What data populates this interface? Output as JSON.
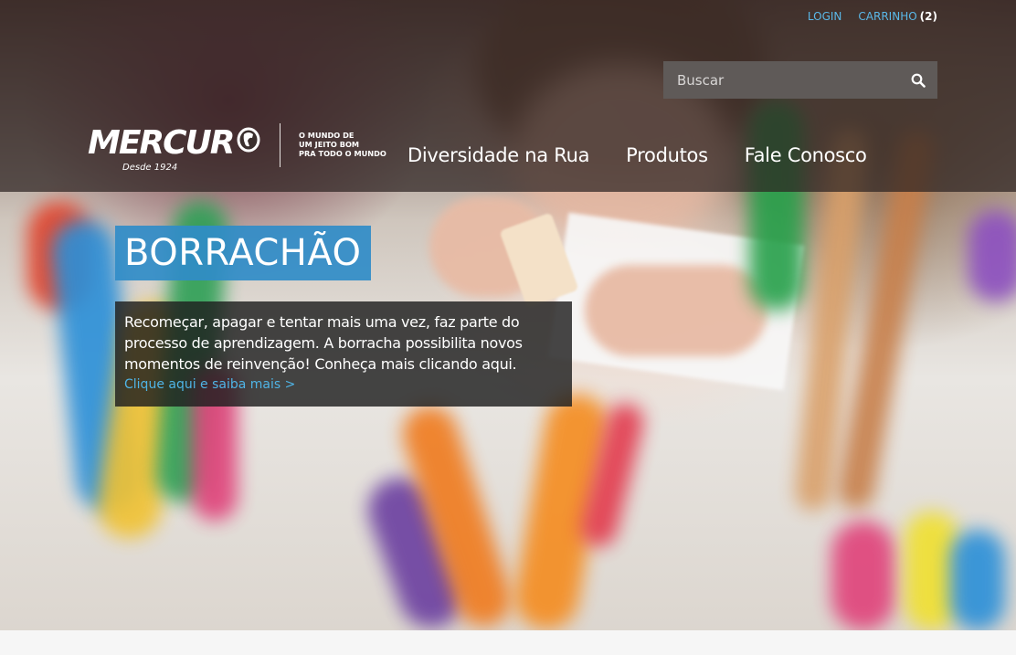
{
  "topnav": {
    "login": "LOGIN",
    "cart": "CARRINHO",
    "cart_count": "(2)"
  },
  "search": {
    "placeholder": "Buscar"
  },
  "logo": {
    "name": "MERCUR",
    "since": "Desde 1924"
  },
  "tagline": {
    "line1": "O MUNDO DE",
    "line2": "UM JEITO BOM",
    "line3": "PRA TODO O MUNDO"
  },
  "mainnav": {
    "items": [
      {
        "label": "Diversidade na Rua"
      },
      {
        "label": "Produtos"
      },
      {
        "label": "Fale Conosco"
      }
    ]
  },
  "banner": {
    "title": "BORRACHÃO",
    "text": "Recomeçar, apagar e tentar mais uma vez, faz parte do processo de aprendizagem. A borracha possibilita novos momentos de reinvenção! Conheça mais clicando aqui.",
    "link": "Clique aqui e saiba mais >"
  },
  "colors": {
    "accent": "#308cc8",
    "link": "#5ab8e8",
    "header_overlay": "#2d2321"
  },
  "icons": {
    "search": "search-icon",
    "emblem": "mercur-emblem-icon"
  }
}
